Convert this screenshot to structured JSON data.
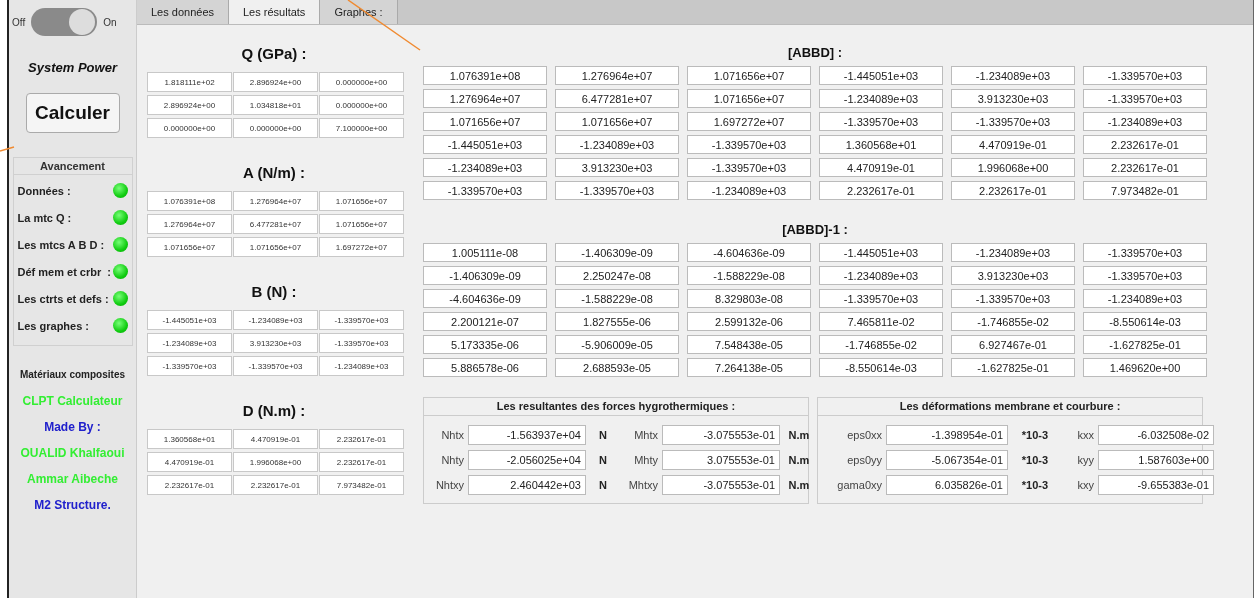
{
  "sidebar": {
    "power_switch": {
      "off_label": "Off",
      "on_label": "On",
      "on": true
    },
    "power_label": "System Power",
    "calculate_button": "Calculer",
    "progress": {
      "title": "Avancement",
      "items": [
        {
          "label": "Données :",
          "done": true
        },
        {
          "label": "La mtc Q :",
          "done": true
        },
        {
          "label": "Les mtcs A B D :",
          "done": true
        },
        {
          "label": "Déf mem et crbr  :",
          "done": true
        },
        {
          "label": "Les ctrts et defs :",
          "done": true
        },
        {
          "label": "Les graphes :",
          "done": true
        }
      ]
    },
    "credits": [
      {
        "text": "Matériaux composites",
        "color": "#222222"
      },
      {
        "text": "CLPT Calculateur",
        "color": "#33ee33"
      },
      {
        "text": "Made By :",
        "color": "#2020cc"
      },
      {
        "text": "OUALID Khalfaoui",
        "color": "#33ee33"
      },
      {
        "text": "Ammar Aibeche",
        "color": "#33ee33"
      },
      {
        "text": "M2 Structure.",
        "color": "#2020cc"
      }
    ]
  },
  "tabs": [
    {
      "label": "Les données",
      "selected": false
    },
    {
      "label": "Les résultats",
      "selected": true
    },
    {
      "label": "Graphes :",
      "selected": false
    }
  ],
  "small_matrices": [
    {
      "title": "Q (GPa) :",
      "rows": [
        [
          "1.818111e+02",
          "2.896924e+00",
          "0.000000e+00"
        ],
        [
          "2.896924e+00",
          "1.034818e+01",
          "0.000000e+00"
        ],
        [
          "0.000000e+00",
          "0.000000e+00",
          "7.100000e+00"
        ]
      ]
    },
    {
      "title": "A (N/m) :",
      "rows": [
        [
          "1.076391e+08",
          "1.276964e+07",
          "1.071656e+07"
        ],
        [
          "1.276964e+07",
          "6.477281e+07",
          "1.071656e+07"
        ],
        [
          "1.071656e+07",
          "1.071656e+07",
          "1.697272e+07"
        ]
      ]
    },
    {
      "title": "B (N) :",
      "rows": [
        [
          "-1.445051e+03",
          "-1.234089e+03",
          "-1.339570e+03"
        ],
        [
          "-1.234089e+03",
          "3.913230e+03",
          "-1.339570e+03"
        ],
        [
          "-1.339570e+03",
          "-1.339570e+03",
          "-1.234089e+03"
        ]
      ]
    },
    {
      "title": "D (N.m) :",
      "rows": [
        [
          "1.360568e+01",
          "4.470919e-01",
          "2.232617e-01"
        ],
        [
          "4.470919e-01",
          "1.996068e+00",
          "2.232617e-01"
        ],
        [
          "2.232617e-01",
          "2.232617e-01",
          "7.973482e-01"
        ]
      ]
    }
  ],
  "big_matrices": [
    {
      "title": "[ABBD] :",
      "rows": [
        [
          "1.076391e+08",
          "1.276964e+07",
          "1.071656e+07",
          "-1.445051e+03",
          "-1.234089e+03",
          "-1.339570e+03"
        ],
        [
          "1.276964e+07",
          "6.477281e+07",
          "1.071656e+07",
          "-1.234089e+03",
          "3.913230e+03",
          "-1.339570e+03"
        ],
        [
          "1.071656e+07",
          "1.071656e+07",
          "1.697272e+07",
          "-1.339570e+03",
          "-1.339570e+03",
          "-1.234089e+03"
        ],
        [
          "-1.445051e+03",
          "-1.234089e+03",
          "-1.339570e+03",
          "1.360568e+01",
          "4.470919e-01",
          "2.232617e-01"
        ],
        [
          "-1.234089e+03",
          "3.913230e+03",
          "-1.339570e+03",
          "4.470919e-01",
          "1.996068e+00",
          "2.232617e-01"
        ],
        [
          "-1.339570e+03",
          "-1.339570e+03",
          "-1.234089e+03",
          "2.232617e-01",
          "2.232617e-01",
          "7.973482e-01"
        ]
      ]
    },
    {
      "title": "[ABBD]-1 :",
      "rows": [
        [
          "1.005111e-08",
          "-1.406309e-09",
          "-4.604636e-09",
          "-1.445051e+03",
          "-1.234089e+03",
          "-1.339570e+03"
        ],
        [
          "-1.406309e-09",
          "2.250247e-08",
          "-1.588229e-08",
          "-1.234089e+03",
          "3.913230e+03",
          "-1.339570e+03"
        ],
        [
          "-4.604636e-09",
          "-1.588229e-08",
          "8.329803e-08",
          "-1.339570e+03",
          "-1.339570e+03",
          "-1.234089e+03"
        ],
        [
          "2.200121e-07",
          "1.827555e-06",
          "2.599132e-06",
          "7.465811e-02",
          "-1.746855e-02",
          "-8.550614e-03"
        ],
        [
          "5.173335e-06",
          "-5.906009e-05",
          "7.548438e-05",
          "-1.746855e-02",
          "6.927467e-01",
          "-1.627825e-01"
        ],
        [
          "5.886578e-06",
          "2.688593e-05",
          "7.264138e-05",
          "-8.550614e-03",
          "-1.627825e-01",
          "1.469620e+00"
        ]
      ]
    }
  ],
  "result_groups": [
    {
      "title": "Les resultantes des forces hygrothermiques :",
      "rows": [
        {
          "label": "Nhtx",
          "value": "-1.563937e+04",
          "unit": "N",
          "label2": "Mhtx",
          "value2": "-3.075553e-01",
          "unit2": "N.m"
        },
        {
          "label": "Nhty",
          "value": "-2.056025e+04",
          "unit": "N",
          "label2": "Mhty",
          "value2": "3.075553e-01",
          "unit2": "N.m"
        },
        {
          "label": "Nhtxy",
          "value": "2.460442e+03",
          "unit": "N",
          "label2": "Mhtxy",
          "value2": "-3.075553e-01",
          "unit2": "N.m"
        }
      ]
    },
    {
      "title": "Les déformations membrane et courbure :",
      "rows": [
        {
          "label": "eps0xx",
          "value": "-1.398954e-01",
          "unit": "*10-3",
          "label2": "kxx",
          "value2": "-6.032508e-02"
        },
        {
          "label": "eps0yy",
          "value": "-5.067354e-01",
          "unit": "*10-3",
          "label2": "kyy",
          "value2": "1.587603e+00"
        },
        {
          "label": "gama0xy",
          "value": "6.035826e-01",
          "unit": "*10-3",
          "label2": "kxy",
          "value2": "-9.655383e-01"
        }
      ]
    }
  ]
}
